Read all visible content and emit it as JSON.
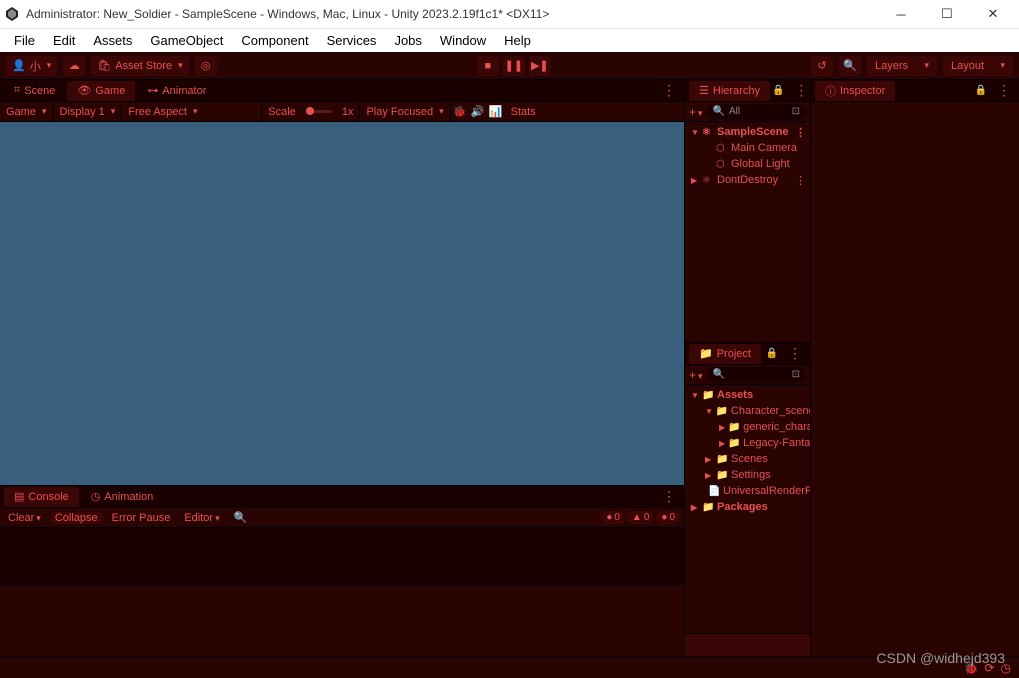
{
  "window": {
    "title": "Administrator: New_Soldier - SampleScene - Windows, Mac, Linux - Unity 2023.2.19f1c1* <DX11>"
  },
  "menu": [
    "File",
    "Edit",
    "Assets",
    "GameObject",
    "Component",
    "Services",
    "Jobs",
    "Window",
    "Help"
  ],
  "toolbar": {
    "account": "小",
    "asset_store": "Asset Store",
    "layers": "Layers",
    "layout": "Layout"
  },
  "tabs": {
    "scene": "Scene",
    "game": "Game",
    "animator": "Animator",
    "console": "Console",
    "animation": "Animation",
    "hierarchy": "Hierarchy",
    "project": "Project",
    "inspector": "Inspector"
  },
  "game_toolbar": {
    "device": "Game",
    "display": "Display 1",
    "aspect": "Free Aspect",
    "scale_label": "Scale",
    "scale_value": "1x",
    "play_mode": "Play Focused",
    "stats": "Stats"
  },
  "console": {
    "clear": "Clear",
    "collapse": "Collapse",
    "error_pause": "Error Pause",
    "editor": "Editor",
    "count_error": "0",
    "count_warn": "0",
    "count_info": "0"
  },
  "hierarchy": {
    "search_placeholder": "All",
    "items": [
      {
        "name": "SampleScene",
        "depth": 0,
        "icon": "scene",
        "bold": true,
        "arrow": "▼"
      },
      {
        "name": "Main Camera",
        "depth": 1,
        "icon": "go"
      },
      {
        "name": "Global Light",
        "depth": 1,
        "icon": "go"
      },
      {
        "name": "DontDestroy",
        "depth": 0,
        "icon": "scene",
        "arrow": "▶"
      }
    ]
  },
  "project": {
    "items": [
      {
        "name": "Assets",
        "depth": 0,
        "icon": "folder",
        "bold": true,
        "arrow": "▼"
      },
      {
        "name": "Character_scene",
        "depth": 1,
        "icon": "folder",
        "arrow": "▼"
      },
      {
        "name": "generic_character",
        "depth": 2,
        "icon": "folder",
        "arrow": "▶"
      },
      {
        "name": "Legacy-Fantasy",
        "depth": 2,
        "icon": "folder",
        "arrow": "▶"
      },
      {
        "name": "Scenes",
        "depth": 1,
        "icon": "folder",
        "arrow": "▶"
      },
      {
        "name": "Settings",
        "depth": 1,
        "icon": "folder",
        "arrow": "▶"
      },
      {
        "name": "UniversalRenderPipeline",
        "depth": 1,
        "icon": "asset"
      },
      {
        "name": "Packages",
        "depth": 0,
        "icon": "folder",
        "bold": true,
        "arrow": "▶"
      }
    ]
  },
  "watermark": "CSDN @widhejd393"
}
